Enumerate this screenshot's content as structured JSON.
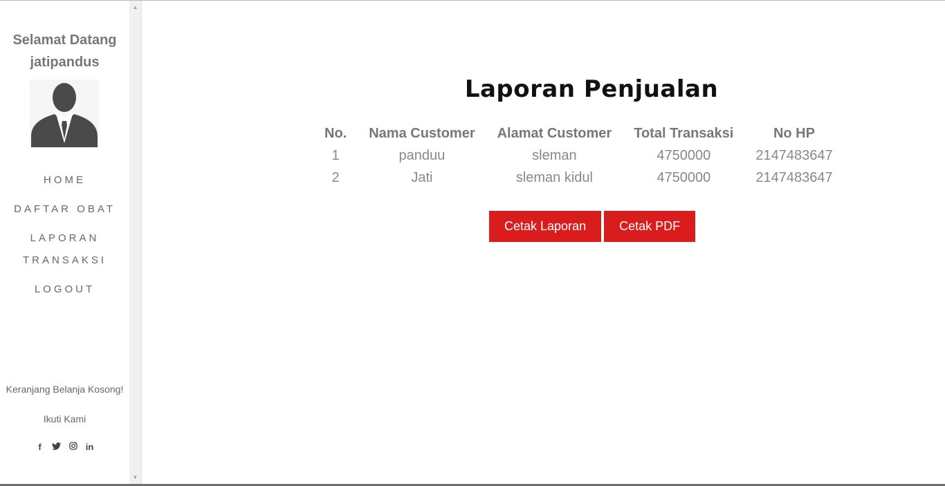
{
  "sidebar": {
    "welcome_line1": "Selamat Datang",
    "welcome_line2": "jatipandus",
    "avatar_icon": "user-avatar-icon",
    "nav": [
      {
        "label": "HOME"
      },
      {
        "label": "DAFTAR OBAT"
      },
      {
        "label": "LAPORAN TRANSAKSI"
      },
      {
        "label": "LOGOUT"
      }
    ],
    "cart_message": "Keranjang Belanja Kosong!",
    "follow_label": "Ikuti Kami",
    "social_icons": [
      "facebook-icon",
      "twitter-icon",
      "instagram-icon",
      "linkedin-icon"
    ]
  },
  "main": {
    "title": "Laporan Penjualan",
    "table": {
      "headers": [
        "No.",
        "Nama Customer",
        "Alamat Customer",
        "Total Transaksi",
        "No HP"
      ],
      "rows": [
        [
          "1",
          "panduu",
          "sleman",
          "4750000",
          "2147483647"
        ],
        [
          "2",
          "Jati",
          "sleman kidul",
          "4750000",
          "2147483647"
        ]
      ]
    },
    "buttons": {
      "print_report": "Cetak Laporan",
      "print_pdf": "Cetak PDF"
    }
  },
  "colors": {
    "accent": "#d91c1c",
    "text_muted": "#777777",
    "heading": "#111111"
  }
}
